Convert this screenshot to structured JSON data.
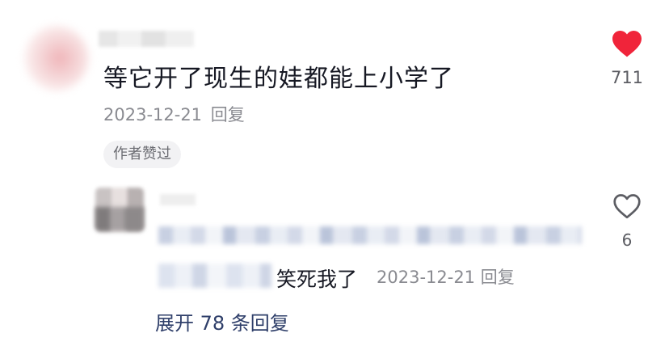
{
  "comments": [
    {
      "text": "等它开了现生的娃都能上小学了",
      "date": "2023-12-21",
      "reply_label": "回复",
      "badge": "作者赞过",
      "like_count": "711",
      "liked": true
    },
    {
      "text_visible": "笑死我了",
      "date": "2023-12-21",
      "reply_label": "回复",
      "like_count": "6",
      "liked": false
    }
  ],
  "expand_replies": "展开 78 条回复",
  "colors": {
    "like_active": "#f0243a",
    "like_inactive": "#5c5d63",
    "text_primary": "#161823",
    "text_secondary": "#8a8b91",
    "link": "#2f3f6a"
  }
}
